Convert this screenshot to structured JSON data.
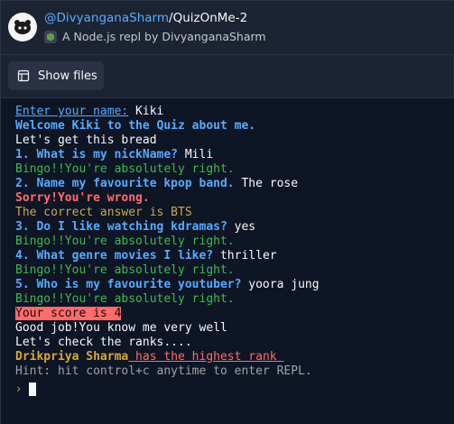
{
  "header": {
    "owner": "@DivyanganaSharm",
    "separator": "/",
    "repl_name": "QuizOnMe-2",
    "subtitle": "A Node.js repl by DivyanganaSharm"
  },
  "toolbar": {
    "show_files_label": "Show files"
  },
  "console": {
    "lines": [
      {
        "prompt": "Enter your name:",
        "answer": " Kiki"
      },
      {
        "text": "Welcome Kiki to the Quiz about me."
      },
      {
        "text": "Let's get this bread"
      },
      {
        "question": "1. What is my nickName?",
        "answer": " Mili"
      },
      {
        "text": "Bingo!!You're absolutely right."
      },
      {
        "question": "2. Name my favourite kpop band.",
        "answer": " The rose"
      },
      {
        "text": "Sorry!You're wrong."
      },
      {
        "text": "The correct answer is BTS"
      },
      {
        "question": "3. Do I like watching kdramas?",
        "answer": " yes"
      },
      {
        "text": "Bingo!!You're absolutely right."
      },
      {
        "question": "4. What genre movies I like?",
        "answer": " thriller"
      },
      {
        "text": "Bingo!!You're absolutely right."
      },
      {
        "question": "5. Who is my favourite youtuber?",
        "answer": " yoora jung"
      },
      {
        "text": "Bingo!!You're absolutely right."
      },
      {
        "text": "Your score is 4"
      },
      {
        "text": "Good job!You know me very well"
      },
      {
        "text": "Let's check the ranks...."
      },
      {
        "name": "Drikpriya Sharma",
        "rest": " has the highest rank "
      },
      {
        "text": "Hint: hit control+c anytime to enter REPL."
      }
    ],
    "prompt_symbol": "›"
  },
  "colors": {
    "background": "#1c2333",
    "console_bg": "#0e1525",
    "blue": "#57abff",
    "green": "#3fb950",
    "red": "#ff6c6c",
    "gold": "#d7a93a"
  }
}
